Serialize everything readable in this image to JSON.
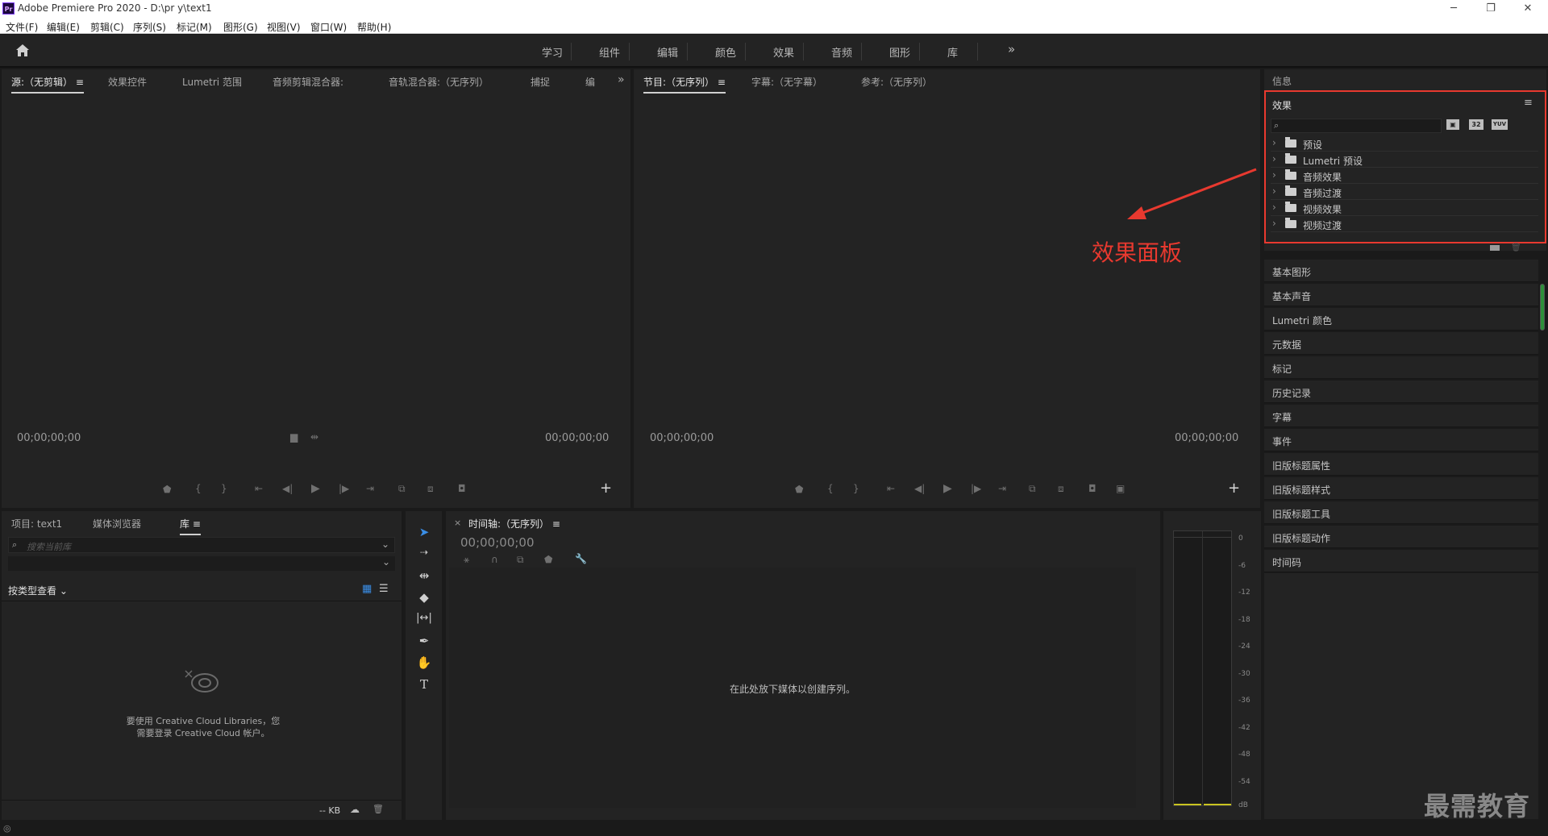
{
  "window": {
    "title": "Adobe Premiere Pro 2020 - D:\\pr y\\text1",
    "app_logo": "Pr",
    "minimize": "─",
    "restore": "❐",
    "close": "✕"
  },
  "menu": [
    "文件(F)",
    "编辑(E)",
    "剪辑(C)",
    "序列(S)",
    "标记(M)",
    "图形(G)",
    "视图(V)",
    "窗口(W)",
    "帮助(H)"
  ],
  "workspaces": [
    "学习",
    "组件",
    "编辑",
    "颜色",
    "效果",
    "音频",
    "图形",
    "库"
  ],
  "workspaces_more": "»",
  "source_panel": {
    "tabs": [
      "源:（无剪辑）",
      "效果控件",
      "Lumetri 范围",
      "音频剪辑混合器:",
      "音轨混合器:（无序列）",
      "捕捉",
      "编"
    ],
    "menu_icon": "≡",
    "more": "»",
    "timecode_left": "00;00;00;00",
    "timecode_right": "00;00;00;00",
    "add": "+"
  },
  "program_panel": {
    "tabs": [
      "节目:（无序列）",
      "字幕:（无字幕）",
      "参考:（无序列）"
    ],
    "menu_icon": "≡",
    "timecode_left": "00;00;00;00",
    "timecode_right": "00;00;00;00",
    "add": "+"
  },
  "right_panel": {
    "info_tab": "信息",
    "effects": {
      "title": "效果",
      "menu_icon": "≡",
      "buttons": [
        "32",
        "YUV"
      ],
      "items": [
        "预设",
        "Lumetri 预设",
        "音频效果",
        "音频过渡",
        "视频效果",
        "视频过渡"
      ]
    },
    "collapsed_panels": [
      "基本图形",
      "基本声音",
      "Lumetri 颜色",
      "元数据",
      "标记",
      "历史记录",
      "字幕",
      "事件",
      "旧版标题属性",
      "旧版标题样式",
      "旧版标题工具",
      "旧版标题动作",
      "时间码"
    ]
  },
  "annotation": {
    "label": "效果面板",
    "color": "#e8392f"
  },
  "project_panel": {
    "tabs": [
      "项目: text1",
      "媒体浏览器",
      "库"
    ],
    "menu_icon": "≡",
    "search_placeholder": "搜索当前库",
    "view_by": "按类型查看",
    "cc_message_line1": "要使用 Creative Cloud Libraries，您",
    "cc_message_line2": "需要登录 Creative Cloud 帐户。",
    "storage": "-- KB"
  },
  "timeline_panel": {
    "close": "×",
    "tab": "时间轴:（无序列）",
    "menu_icon": "≡",
    "timecode": "00;00;00;00",
    "empty_message": "在此处放下媒体以创建序列。"
  },
  "audio_meter": {
    "ticks": [
      "0",
      "-6",
      "-12",
      "-18",
      "-24",
      "-30",
      "-36",
      "-42",
      "-48",
      "-54",
      "dB"
    ]
  },
  "watermark": "最需教育",
  "colors": {
    "accent_blue": "#3a8ee6",
    "highlight_red": "#e8392f",
    "meter_yellow": "#c9c420"
  }
}
